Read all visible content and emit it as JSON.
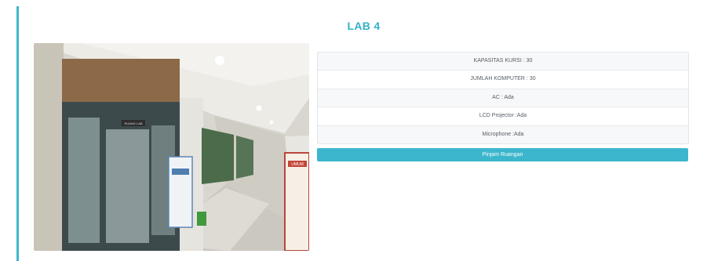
{
  "room": {
    "title": "LAB 4"
  },
  "photo": {
    "description_icon": "room-photo",
    "door_sign": "RUANG LAB",
    "banner_text": "UMUM"
  },
  "details": [
    {
      "text": "KAPASITAS KURSI : 30"
    },
    {
      "text": "JUMLAH KOMPUTER : 30"
    },
    {
      "text": "AC : Ada"
    },
    {
      "text": "LCD Projector :Ada"
    },
    {
      "text": "Microphone :Ada"
    }
  ],
  "actions": {
    "borrow_label": "Pinjam Ruangan"
  },
  "colors": {
    "accent": "#3cb6cd",
    "title": "#34b1c9"
  }
}
